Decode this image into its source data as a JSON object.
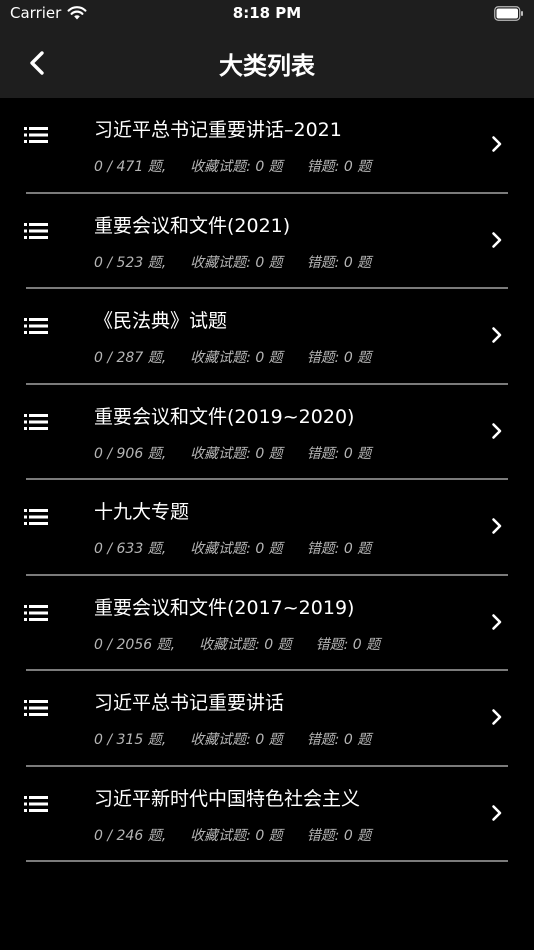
{
  "status_bar": {
    "carrier": "Carrier",
    "time": "8:18 PM"
  },
  "nav": {
    "title": "大类列表",
    "back_icon": "chevron-left-icon"
  },
  "categories": [
    {
      "title": "习近平总书记重要讲话–2021",
      "progress": "0 / 471 题,",
      "favorites": "收藏试题: 0 题",
      "errors": "错题: 0 题"
    },
    {
      "title": "重要会议和文件(2021)",
      "progress": "0 / 523 题,",
      "favorites": "收藏试题: 0 题",
      "errors": "错题: 0 题"
    },
    {
      "title": "《民法典》试题",
      "progress": "0 / 287 题,",
      "favorites": "收藏试题: 0 题",
      "errors": "错题: 0 题"
    },
    {
      "title": "重要会议和文件(2019~2020)",
      "progress": "0 / 906 题,",
      "favorites": "收藏试题: 0 题",
      "errors": "错题: 0 题"
    },
    {
      "title": "十九大专题",
      "progress": "0 / 633 题,",
      "favorites": "收藏试题: 0 题",
      "errors": "错题: 0 题"
    },
    {
      "title": "重要会议和文件(2017~2019)",
      "progress": "0 / 2056 题,",
      "favorites": "收藏试题: 0 题",
      "errors": "错题: 0 题"
    },
    {
      "title": "习近平总书记重要讲话",
      "progress": "0 / 315 题,",
      "favorites": "收藏试题: 0 题",
      "errors": "错题: 0 题"
    },
    {
      "title": "习近平新时代中国特色社会主义",
      "progress": "0 / 246 题,",
      "favorites": "收藏试题: 0 题",
      "errors": "错题: 0 题"
    }
  ],
  "colors": {
    "background": "#000000",
    "bar": "#1e1e1e",
    "divider": "#7b7b7b",
    "stats_text": "#b5b5b5"
  }
}
